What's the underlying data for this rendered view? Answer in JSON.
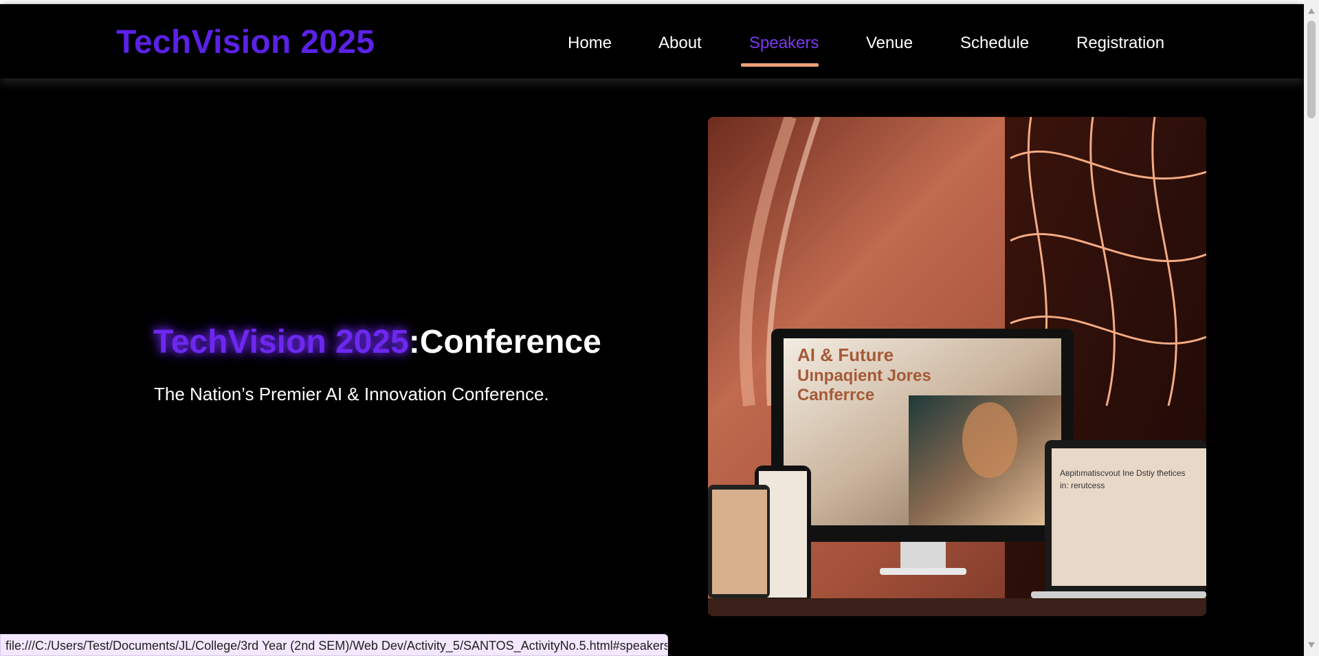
{
  "header": {
    "logo": "TechVision 2025",
    "nav": [
      {
        "label": "Home"
      },
      {
        "label": "About"
      },
      {
        "label": "Speakers",
        "active": true
      },
      {
        "label": "Venue"
      },
      {
        "label": "Schedule"
      },
      {
        "label": "Registration"
      }
    ]
  },
  "hero": {
    "title_brand": "TechVision 2025",
    "title_rest": ":Conference",
    "subtitle": "The Nation’s Premier AI & Innovation Conference.",
    "image": {
      "screen_text_line1": "AI & Future",
      "screen_text_line2": "Uınpaqient Jores",
      "screen_text_line3": "Canferrce",
      "laptop_text_line1": "Aвріtımatiscvout Ine Dstiy tħetices",
      "laptop_text_line2": "in: rerutcess"
    }
  },
  "status_bar": {
    "url": "file:///C:/Users/Test/Documents/JL/College/3rd Year (2nd SEM)/Web Dev/Activity_5/SANTOS_ActivityNo.5.html#speakers"
  },
  "colors": {
    "brand": "#5b21e6",
    "active_nav": "#7c3aed",
    "underline": "#f0a07a",
    "background": "#000000"
  },
  "icons": {
    "scroll_up": "triangle-up",
    "scroll_down": "triangle-down"
  }
}
